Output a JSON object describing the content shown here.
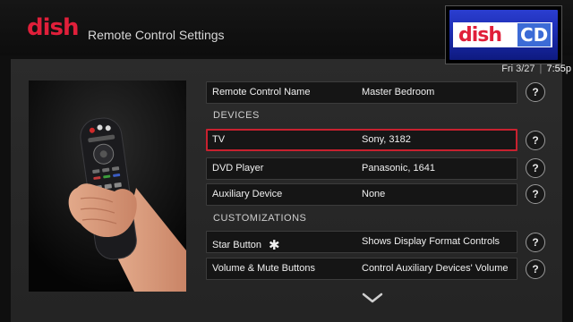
{
  "header": {
    "logo_text": "dish",
    "title": "Remote Control Settings",
    "channel_logo": {
      "brand": "dish",
      "suffix": "CD"
    }
  },
  "status": {
    "date": "Fri 3/27",
    "separator": "|",
    "time": "7:55p"
  },
  "settings": {
    "remote_name": {
      "label": "Remote Control Name",
      "value": "Master Bedroom"
    },
    "devices_header": "DEVICES",
    "devices": [
      {
        "label": "TV",
        "value": "Sony, 3182"
      },
      {
        "label": "DVD Player",
        "value": "Panasonic, 1641"
      },
      {
        "label": "Auxiliary Device",
        "value": "None"
      }
    ],
    "customizations_header": "CUSTOMIZATIONS",
    "customizations": [
      {
        "label": "Star Button",
        "value": "Shows Display Format Controls",
        "icon": "asterisk-icon"
      },
      {
        "label": "Volume & Mute Buttons",
        "value": "Control Auxiliary Devices' Volume"
      }
    ],
    "help_label": "?"
  },
  "icons": {
    "help": "question-mark-icon",
    "scroll": "chevron-down-icon"
  },
  "colors": {
    "accent": "#e01f3a",
    "selection": "#c8212f",
    "panel": "#262626",
    "background": "#0f0f0f"
  }
}
